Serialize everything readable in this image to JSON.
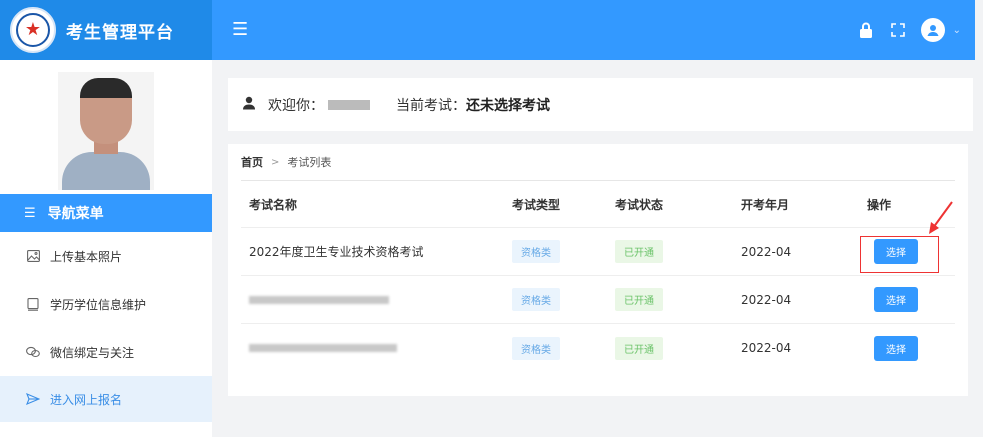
{
  "app": {
    "title": "考生管理平台"
  },
  "header": {
    "menu_icon": "hamburger-icon",
    "icons": [
      "lock-icon",
      "fullscreen-icon",
      "user-avatar-icon",
      "chevron-down-icon"
    ]
  },
  "sidebar": {
    "nav_title": "导航菜单",
    "items": [
      {
        "label": "上传基本照片",
        "icon": "image-icon"
      },
      {
        "label": "学历学位信息维护",
        "icon": "document-icon"
      },
      {
        "label": "微信绑定与关注",
        "icon": "wechat-icon"
      },
      {
        "label": "进入网上报名",
        "icon": "send-icon",
        "active": true
      }
    ]
  },
  "welcome": {
    "greeting": "欢迎你：",
    "exam_label": "当前考试：",
    "exam_value": "还未选择考试"
  },
  "breadcrumb": {
    "home": "首页",
    "current": "考试列表"
  },
  "table": {
    "headers": [
      "考试名称",
      "考试类型",
      "考试状态",
      "开考年月",
      "操作"
    ],
    "rows": [
      {
        "name": "2022年度卫生专业技术资格考试",
        "type": "资格类",
        "status": "已开通",
        "date": "2022-04",
        "action": "选择"
      },
      {
        "name": "",
        "type": "资格类",
        "status": "已开通",
        "date": "2022-04",
        "action": "选择"
      },
      {
        "name": "",
        "type": "资格类",
        "status": "已开通",
        "date": "2022-04",
        "action": "选择"
      }
    ]
  },
  "colors": {
    "brand": "#1f8ae8",
    "header": "#3399ff",
    "active_bg": "#e6f1fc",
    "annotation": "#ee3333"
  }
}
